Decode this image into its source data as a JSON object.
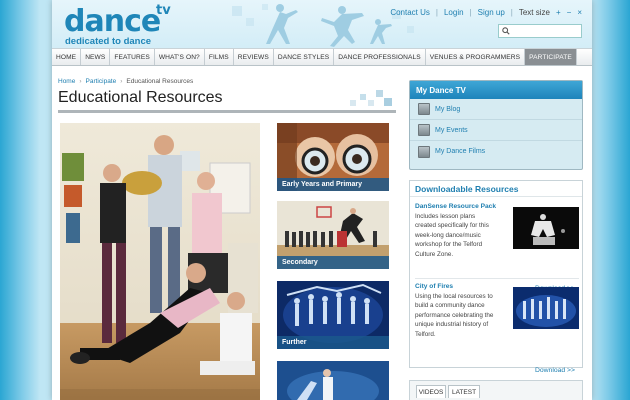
{
  "header": {
    "logo_word": "dance",
    "logo_tv": "tv",
    "tagline": "dedicated to dance",
    "links": [
      "Contact Us",
      "Login",
      "Sign up"
    ],
    "text_size_label": "Text size",
    "text_size_controls": [
      "+",
      "−",
      "×"
    ],
    "search_placeholder": ""
  },
  "nav": {
    "items": [
      "HOME",
      "NEWS",
      "FEATURES",
      "WHAT'S ON?",
      "FILMS",
      "REVIEWS",
      "DANCE STYLES",
      "DANCE PROFESSIONALS",
      "VENUES & PROGRAMMERS",
      "PARTICIPATE"
    ],
    "active_index": 9
  },
  "breadcrumb": [
    "Home",
    "Participate",
    "Educational Resources"
  ],
  "page_title": "Educational Resources",
  "thumbnails": [
    {
      "label": "Early Years and Primary"
    },
    {
      "label": "Secondary"
    },
    {
      "label": "Further"
    },
    {
      "label": ""
    }
  ],
  "my_dance": {
    "title": "My Dance TV",
    "items": [
      "My Blog",
      "My Events",
      "My Dance Films"
    ]
  },
  "downloads": {
    "title": "Downloadable Resources",
    "resources": [
      {
        "title": "DanSense Resource Pack",
        "desc_lines": [
          "Includes lesson plans",
          "created specifically for this",
          "week-long dance/music",
          "workshop for the Telford",
          "Culture Zone."
        ],
        "link": "Download >>"
      },
      {
        "title": "City of Fires",
        "desc_lines": [
          "Using the local resources to",
          "build a community dance",
          "performance celebrating the",
          "unique industrial history of",
          "Telford."
        ],
        "link": "Download >>"
      }
    ]
  },
  "tabs": [
    "VIDEOS",
    "LATEST"
  ],
  "colors": {
    "brand_blue": "#1f86b8",
    "link_blue": "#1f7fb0",
    "nav_active": "#8a8f93",
    "label_bar": "#1b588c"
  }
}
